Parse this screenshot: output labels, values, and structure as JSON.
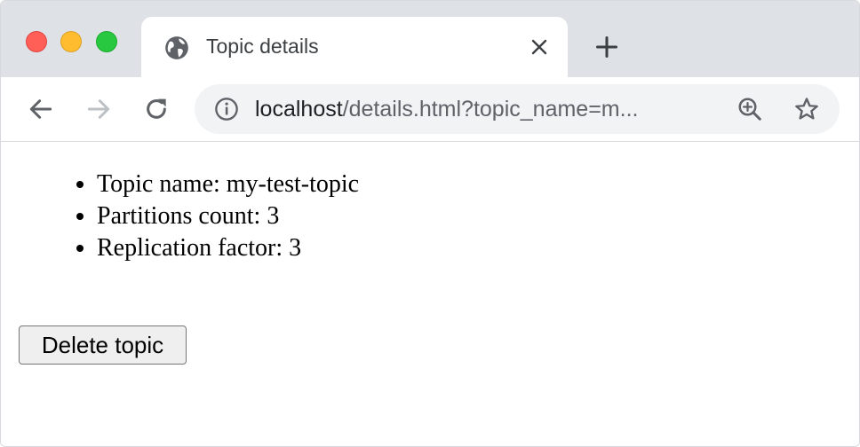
{
  "tab": {
    "title": "Topic details",
    "favicon": "globe-icon"
  },
  "address_bar": {
    "host": "localhost",
    "path": "/details.html?topic_name=m...",
    "info_icon": "info-icon",
    "zoom_icon": "zoom-in-icon",
    "bookmark_icon": "star-icon"
  },
  "topic": {
    "items": [
      {
        "label": "Topic name: my-test-topic"
      },
      {
        "label": "Partitions count: 3"
      },
      {
        "label": "Replication factor: 3"
      }
    ]
  },
  "actions": {
    "delete_label": "Delete topic"
  },
  "colors": {
    "tabstrip": "#dee1e6",
    "omnibox": "#f1f3f4",
    "close_red": "#ff5f57",
    "minimize_yellow": "#febc2e",
    "maximize_green": "#28c840"
  }
}
